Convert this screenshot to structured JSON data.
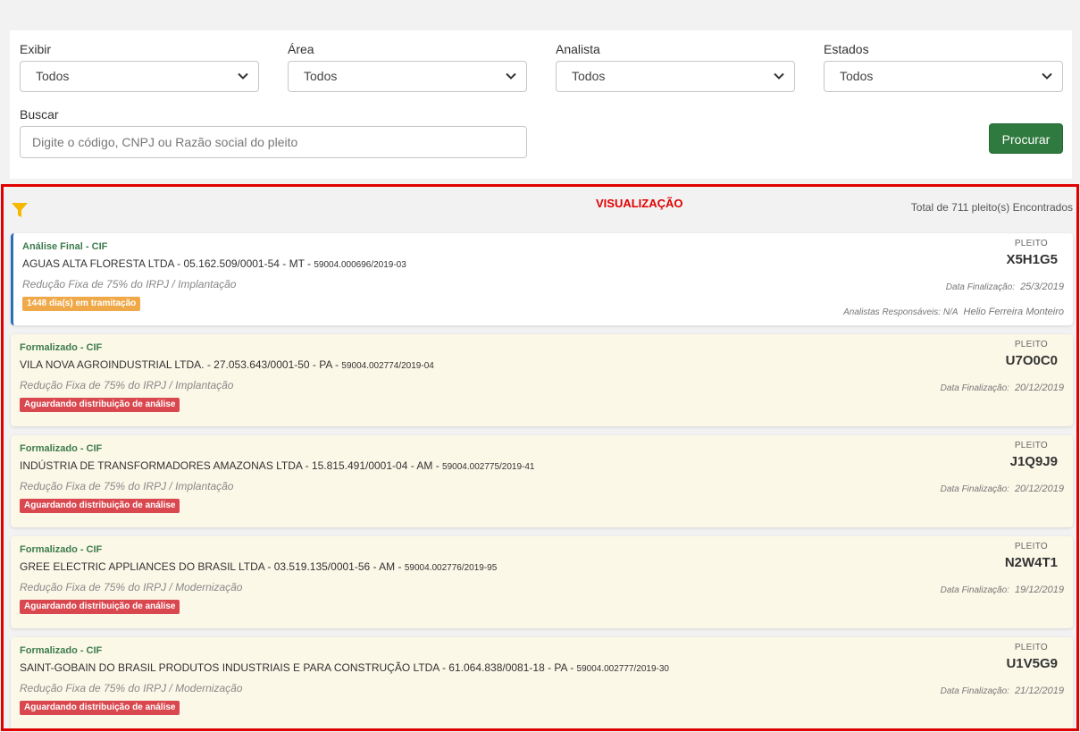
{
  "filters": {
    "exibir": {
      "label": "Exibir",
      "value": "Todos"
    },
    "area": {
      "label": "Área",
      "value": "Todos"
    },
    "analista": {
      "label": "Analista",
      "value": "Todos"
    },
    "estados": {
      "label": "Estados",
      "value": "Todos"
    },
    "buscar": {
      "label": "Buscar",
      "placeholder": "Digite o código, CNPJ ou Razão social do pleito"
    },
    "procurar_label": "Procurar"
  },
  "visualizacao": {
    "title": "VISUALIZAÇÃO",
    "total": "Total de 711 pleito(s) Encontrados"
  },
  "colors": {
    "accent_red": "#e00000",
    "button_green": "#2f7a3e",
    "status_green": "#3c7b4c",
    "badge_orange": "#efa949",
    "badge_red": "#d9484f",
    "card_bg": "#fcf8e8"
  },
  "cards": [
    {
      "status": "Análise Final - CIF",
      "company": "AGUAS ALTA FLORESTA LTDA - 05.162.509/0001-54 - MT - ",
      "process": "59004.000696/2019-03",
      "benefit": "Redução Fixa de 75% do IRPJ / Implantação",
      "badge": "1448 dia(s) em tramitação",
      "pleito_label": "PLEITO",
      "pleito_code": "X5H1G5",
      "data_label": "Data Finalização:",
      "data_value": "25/3/2019",
      "analistas_label": "Analistas Responsáveis: N/A",
      "analistas_value": "Helio Ferreira Monteiro"
    },
    {
      "status": "Formalizado - CIF",
      "company": "VILA NOVA AGROINDUSTRIAL LTDA. - 27.053.643/0001-50 - PA - ",
      "process": "59004.002774/2019-04",
      "benefit": "Redução Fixa de 75% do IRPJ / Implantação",
      "badge": "Aguardando distribuição de análise",
      "pleito_label": "PLEITO",
      "pleito_code": "U7O0C0",
      "data_label": "Data Finalização:",
      "data_value": "20/12/2019"
    },
    {
      "status": "Formalizado - CIF",
      "company": "INDÚSTRIA DE TRANSFORMADORES AMAZONAS LTDA - 15.815.491/0001-04 - AM - ",
      "process": "59004.002775/2019-41",
      "benefit": "Redução Fixa de 75% do IRPJ / Implantação",
      "badge": "Aguardando distribuição de análise",
      "pleito_label": "PLEITO",
      "pleito_code": "J1Q9J9",
      "data_label": "Data Finalização:",
      "data_value": "20/12/2019"
    },
    {
      "status": "Formalizado - CIF",
      "company": "GREE ELECTRIC APPLIANCES DO BRASIL LTDA - 03.519.135/0001-56 - AM - ",
      "process": "59004.002776/2019-95",
      "benefit": "Redução Fixa de 75% do IRPJ / Modernização",
      "badge": "Aguardando distribuição de análise",
      "pleito_label": "PLEITO",
      "pleito_code": "N2W4T1",
      "data_label": "Data Finalização:",
      "data_value": "19/12/2019"
    },
    {
      "status": "Formalizado - CIF",
      "company": "SAINT-GOBAIN DO BRASIL PRODUTOS INDUSTRIAIS E PARA CONSTRUÇÃO LTDA - 61.064.838/0081-18 - PA - ",
      "process": "59004.002777/2019-30",
      "benefit": "Redução Fixa de 75% do IRPJ / Modernização",
      "badge": "Aguardando distribuição de análise",
      "pleito_label": "PLEITO",
      "pleito_code": "U1V5G9",
      "data_label": "Data Finalização:",
      "data_value": "21/12/2019"
    }
  ]
}
